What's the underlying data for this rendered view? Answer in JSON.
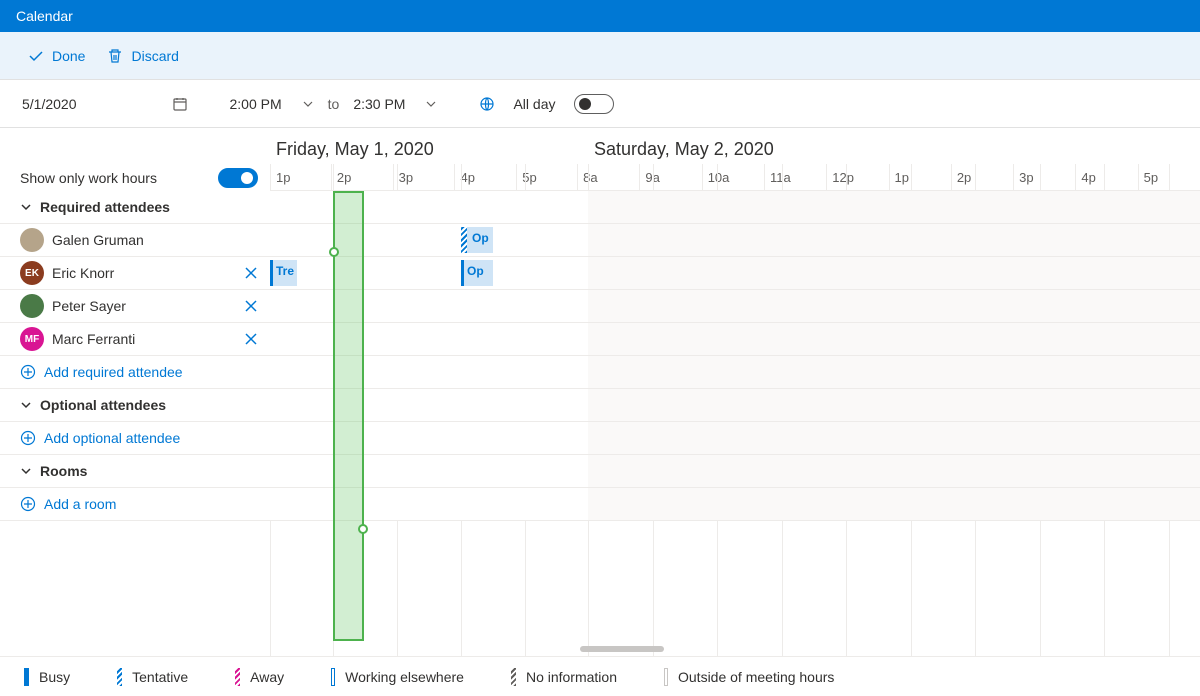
{
  "title": "Calendar",
  "actions": {
    "done": "Done",
    "discard": "Discard"
  },
  "form": {
    "date": "5/1/2020",
    "start_time": "2:00 PM",
    "to": "to",
    "end_time": "2:30 PM",
    "allday_label": "All day",
    "allday": false
  },
  "work_hours_label": "Show only work hours",
  "work_hours_on": true,
  "days": [
    {
      "label": "Friday, May 1, 2020",
      "hours": [
        "1p",
        "2p",
        "3p",
        "4p",
        "5p"
      ]
    },
    {
      "label": "Saturday, May 2, 2020",
      "hours": [
        "8a",
        "9a",
        "10a",
        "11a",
        "12p",
        "1p",
        "2p",
        "3p",
        "4p",
        "5p"
      ]
    }
  ],
  "sections": {
    "required": {
      "label": "Required attendees",
      "add": "Add required attendee"
    },
    "optional": {
      "label": "Optional attendees",
      "add": "Add optional attendee"
    },
    "rooms": {
      "label": "Rooms",
      "add": "Add a room"
    }
  },
  "attendees": [
    {
      "name": "Galen Gruman",
      "initials": "",
      "removable": false
    },
    {
      "name": "Eric Knorr",
      "initials": "EK",
      "removable": true
    },
    {
      "name": "Peter Sayer",
      "initials": "",
      "removable": true
    },
    {
      "name": "Marc Ferranti",
      "initials": "MF",
      "removable": true
    }
  ],
  "events": {
    "gg_op": "Op",
    "ek_tr": "Tre",
    "ek_op": "Op"
  },
  "legend": {
    "busy": "Busy",
    "tentative": "Tentative",
    "away": "Away",
    "elsewhere": "Working elsewhere",
    "noinfo": "No information",
    "outside": "Outside of meeting hours"
  }
}
